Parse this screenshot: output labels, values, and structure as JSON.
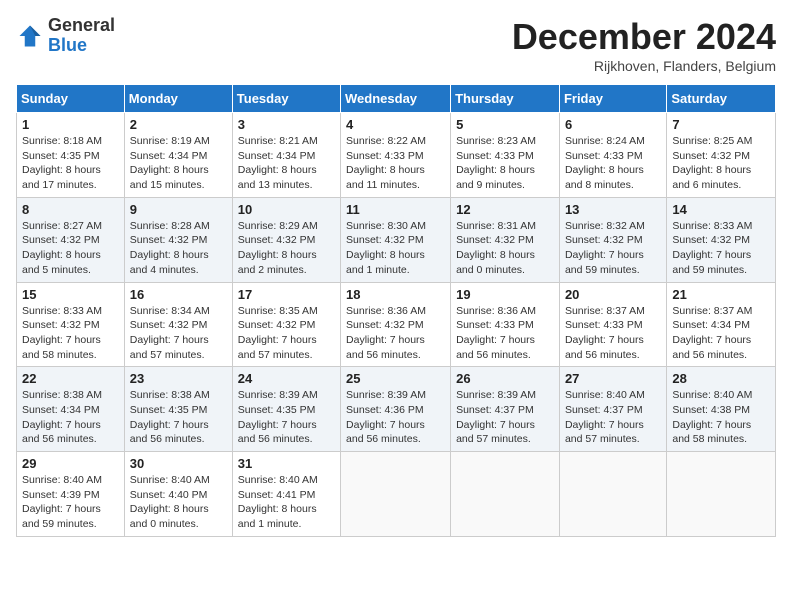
{
  "header": {
    "logo_general": "General",
    "logo_blue": "Blue",
    "title": "December 2024",
    "subtitle": "Rijkhoven, Flanders, Belgium"
  },
  "weekdays": [
    "Sunday",
    "Monday",
    "Tuesday",
    "Wednesday",
    "Thursday",
    "Friday",
    "Saturday"
  ],
  "weeks": [
    [
      {
        "day": "1",
        "sunrise": "8:18 AM",
        "sunset": "4:35 PM",
        "daylight": "8 hours and 17 minutes."
      },
      {
        "day": "2",
        "sunrise": "8:19 AM",
        "sunset": "4:34 PM",
        "daylight": "8 hours and 15 minutes."
      },
      {
        "day": "3",
        "sunrise": "8:21 AM",
        "sunset": "4:34 PM",
        "daylight": "8 hours and 13 minutes."
      },
      {
        "day": "4",
        "sunrise": "8:22 AM",
        "sunset": "4:33 PM",
        "daylight": "8 hours and 11 minutes."
      },
      {
        "day": "5",
        "sunrise": "8:23 AM",
        "sunset": "4:33 PM",
        "daylight": "8 hours and 9 minutes."
      },
      {
        "day": "6",
        "sunrise": "8:24 AM",
        "sunset": "4:33 PM",
        "daylight": "8 hours and 8 minutes."
      },
      {
        "day": "7",
        "sunrise": "8:25 AM",
        "sunset": "4:32 PM",
        "daylight": "8 hours and 6 minutes."
      }
    ],
    [
      {
        "day": "8",
        "sunrise": "8:27 AM",
        "sunset": "4:32 PM",
        "daylight": "8 hours and 5 minutes."
      },
      {
        "day": "9",
        "sunrise": "8:28 AM",
        "sunset": "4:32 PM",
        "daylight": "8 hours and 4 minutes."
      },
      {
        "day": "10",
        "sunrise": "8:29 AM",
        "sunset": "4:32 PM",
        "daylight": "8 hours and 2 minutes."
      },
      {
        "day": "11",
        "sunrise": "8:30 AM",
        "sunset": "4:32 PM",
        "daylight": "8 hours and 1 minute."
      },
      {
        "day": "12",
        "sunrise": "8:31 AM",
        "sunset": "4:32 PM",
        "daylight": "8 hours and 0 minutes."
      },
      {
        "day": "13",
        "sunrise": "8:32 AM",
        "sunset": "4:32 PM",
        "daylight": "7 hours and 59 minutes."
      },
      {
        "day": "14",
        "sunrise": "8:33 AM",
        "sunset": "4:32 PM",
        "daylight": "7 hours and 59 minutes."
      }
    ],
    [
      {
        "day": "15",
        "sunrise": "8:33 AM",
        "sunset": "4:32 PM",
        "daylight": "7 hours and 58 minutes."
      },
      {
        "day": "16",
        "sunrise": "8:34 AM",
        "sunset": "4:32 PM",
        "daylight": "7 hours and 57 minutes."
      },
      {
        "day": "17",
        "sunrise": "8:35 AM",
        "sunset": "4:32 PM",
        "daylight": "7 hours and 57 minutes."
      },
      {
        "day": "18",
        "sunrise": "8:36 AM",
        "sunset": "4:32 PM",
        "daylight": "7 hours and 56 minutes."
      },
      {
        "day": "19",
        "sunrise": "8:36 AM",
        "sunset": "4:33 PM",
        "daylight": "7 hours and 56 minutes."
      },
      {
        "day": "20",
        "sunrise": "8:37 AM",
        "sunset": "4:33 PM",
        "daylight": "7 hours and 56 minutes."
      },
      {
        "day": "21",
        "sunrise": "8:37 AM",
        "sunset": "4:34 PM",
        "daylight": "7 hours and 56 minutes."
      }
    ],
    [
      {
        "day": "22",
        "sunrise": "8:38 AM",
        "sunset": "4:34 PM",
        "daylight": "7 hours and 56 minutes."
      },
      {
        "day": "23",
        "sunrise": "8:38 AM",
        "sunset": "4:35 PM",
        "daylight": "7 hours and 56 minutes."
      },
      {
        "day": "24",
        "sunrise": "8:39 AM",
        "sunset": "4:35 PM",
        "daylight": "7 hours and 56 minutes."
      },
      {
        "day": "25",
        "sunrise": "8:39 AM",
        "sunset": "4:36 PM",
        "daylight": "7 hours and 56 minutes."
      },
      {
        "day": "26",
        "sunrise": "8:39 AM",
        "sunset": "4:37 PM",
        "daylight": "7 hours and 57 minutes."
      },
      {
        "day": "27",
        "sunrise": "8:40 AM",
        "sunset": "4:37 PM",
        "daylight": "7 hours and 57 minutes."
      },
      {
        "day": "28",
        "sunrise": "8:40 AM",
        "sunset": "4:38 PM",
        "daylight": "7 hours and 58 minutes."
      }
    ],
    [
      {
        "day": "29",
        "sunrise": "8:40 AM",
        "sunset": "4:39 PM",
        "daylight": "7 hours and 59 minutes."
      },
      {
        "day": "30",
        "sunrise": "8:40 AM",
        "sunset": "4:40 PM",
        "daylight": "8 hours and 0 minutes."
      },
      {
        "day": "31",
        "sunrise": "8:40 AM",
        "sunset": "4:41 PM",
        "daylight": "8 hours and 1 minute."
      },
      null,
      null,
      null,
      null
    ]
  ]
}
